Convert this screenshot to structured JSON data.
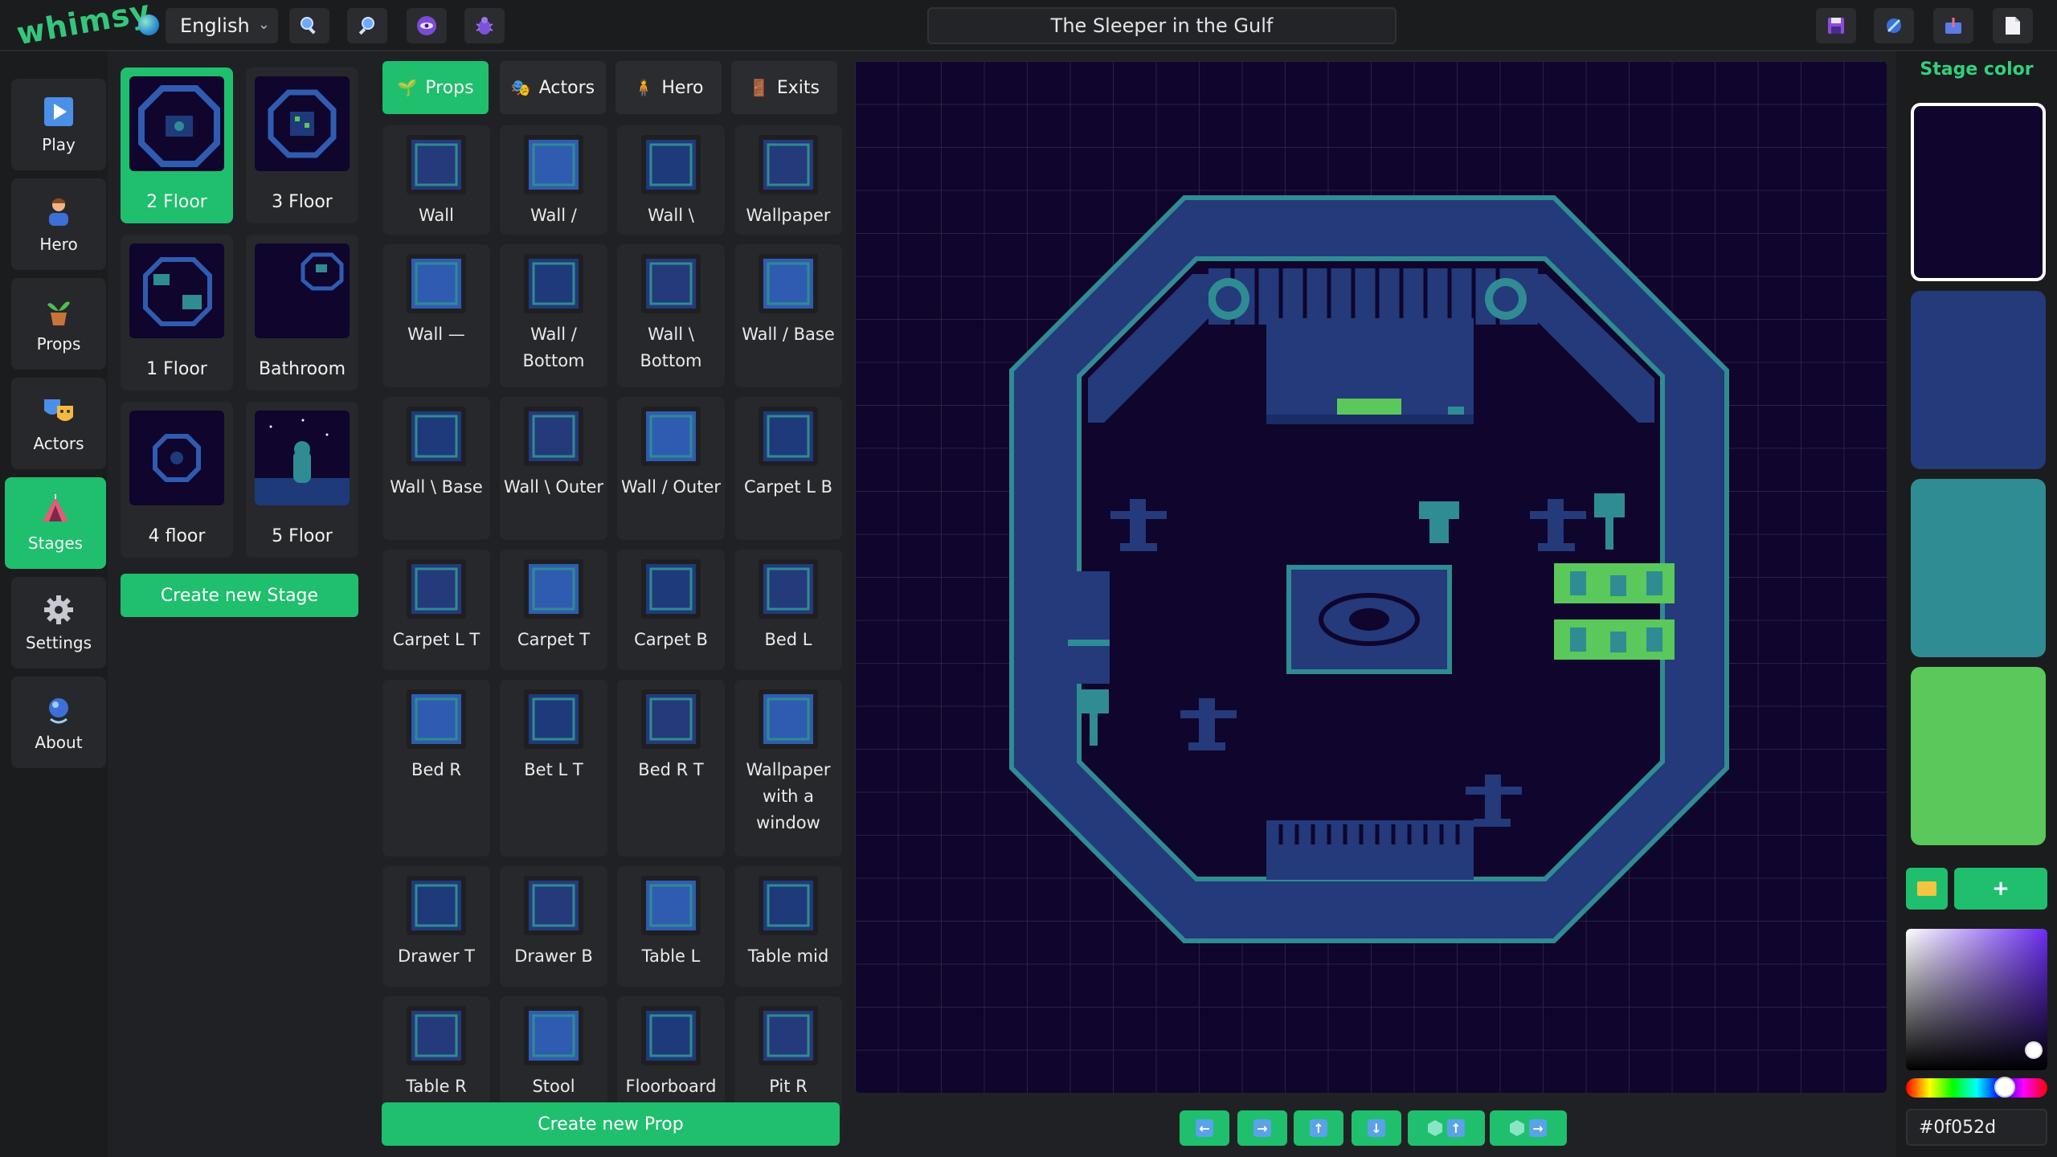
{
  "app": {
    "logo": "whimsy",
    "title": "The Sleeper in the Gulf"
  },
  "topbar": {
    "language": "English",
    "left_tools": [
      "zoom-in-icon",
      "zoom-out-icon",
      "eye-icon",
      "bug-icon"
    ],
    "right_tools": [
      "save-icon",
      "export-icon",
      "import-icon",
      "document-icon"
    ]
  },
  "nav": {
    "items": [
      {
        "label": "Play",
        "icon": "play-icon",
        "active": false
      },
      {
        "label": "Hero",
        "icon": "hero-icon",
        "active": false
      },
      {
        "label": "Props",
        "icon": "plant-icon",
        "active": false
      },
      {
        "label": "Actors",
        "icon": "masks-icon",
        "active": false
      },
      {
        "label": "Stages",
        "icon": "tent-icon",
        "active": true
      },
      {
        "label": "Settings",
        "icon": "gear-icon",
        "active": false
      },
      {
        "label": "About",
        "icon": "info-icon",
        "active": false
      }
    ]
  },
  "stages": {
    "items": [
      {
        "label": "2 Floor",
        "active": true
      },
      {
        "label": "3 Floor",
        "active": false
      },
      {
        "label": "1 Floor",
        "active": false
      },
      {
        "label": "Bathroom",
        "active": false
      },
      {
        "label": "4 floor",
        "active": false
      },
      {
        "label": "5 Floor",
        "active": false
      }
    ],
    "create_label": "Create new Stage"
  },
  "props": {
    "tabs": [
      {
        "label": "Props",
        "icon": "plant-icon",
        "active": true
      },
      {
        "label": "Actors",
        "icon": "masks-icon",
        "active": false
      },
      {
        "label": "Hero",
        "icon": "hero-icon",
        "active": false
      },
      {
        "label": "Exits",
        "icon": "door-icon",
        "active": false
      }
    ],
    "items": [
      "Wall",
      "Wall /",
      "Wall \\",
      "Wallpaper",
      "Wall —",
      "Wall / Bottom",
      "Wall \\ Bottom",
      "Wall / Base",
      "Wall \\ Base",
      "Wall \\ Outer",
      "Wall / Outer",
      "Carpet L B",
      "Carpet L T",
      "Carpet T",
      "Carpet B",
      "Bed L",
      "Bed R",
      "Bet L T",
      "Bed R T",
      "Wallpaper with a window",
      "Drawer T",
      "Drawer B",
      "Table L",
      "Table mid",
      "Table R",
      "Stool",
      "Floorboard",
      "Pit R"
    ],
    "create_label": "Create new Prop"
  },
  "canvas": {
    "background": "#0f052d",
    "wall_color": "#243a7a",
    "edge_color": "#2f8c93",
    "green_color": "#5ac85a",
    "controls": [
      "left-arrow-icon",
      "right-arrow-icon",
      "up-arrow-icon",
      "down-arrow-icon",
      "layer-up-icon",
      "layer-right-icon"
    ]
  },
  "color_panel": {
    "title": "Stage color",
    "swatches": [
      "#0f052d",
      "#243a7a",
      "#2f8c93",
      "#5ac85a"
    ],
    "selected_index": 0,
    "add_label": "+",
    "hex_value": "#0f052d"
  }
}
